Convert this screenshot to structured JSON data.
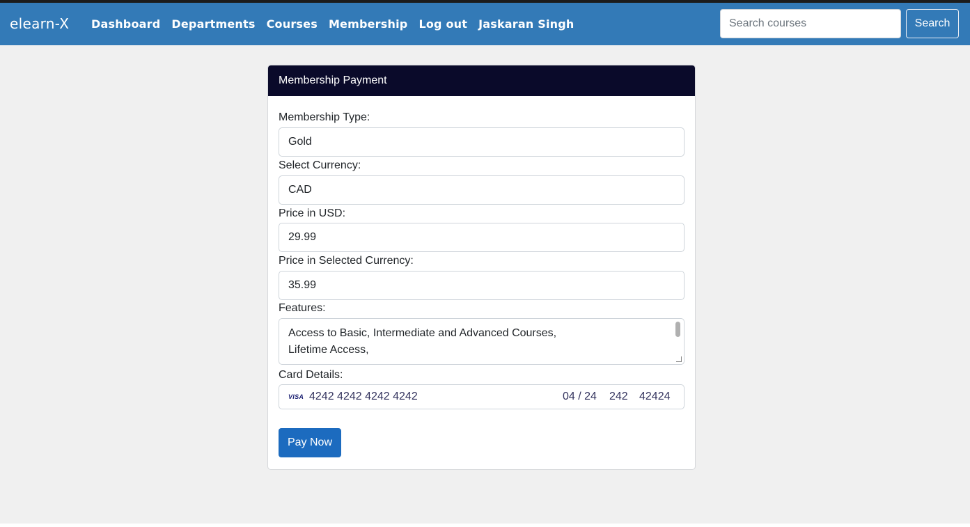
{
  "navbar": {
    "brand": "elearn-X",
    "links": [
      "Dashboard",
      "Departments",
      "Courses",
      "Membership",
      "Log out",
      "Jaskaran Singh"
    ],
    "search_placeholder": "Search courses",
    "search_button": "Search",
    "color": "#337ab7"
  },
  "card": {
    "header": "Membership Payment",
    "membership_type_label": "Membership Type:",
    "membership_type_value": "Gold",
    "currency_label": "Select Currency:",
    "currency_value": "CAD",
    "price_usd_label": "Price in USD:",
    "price_usd_value": "29.99",
    "price_selected_label": "Price in Selected Currency:",
    "price_selected_value": "35.99",
    "features_label": "Features:",
    "features_lines": [
      "Access to Basic, Intermediate and Advanced Courses,",
      "Lifetime Access,"
    ],
    "card_details_label": "Card Details:",
    "card_brand": "VISA",
    "card_number": "4242 4242 4242 4242",
    "card_expiry": "04 / 24",
    "card_cvc": "242",
    "card_zip": "42424",
    "pay_button": "Pay Now"
  }
}
